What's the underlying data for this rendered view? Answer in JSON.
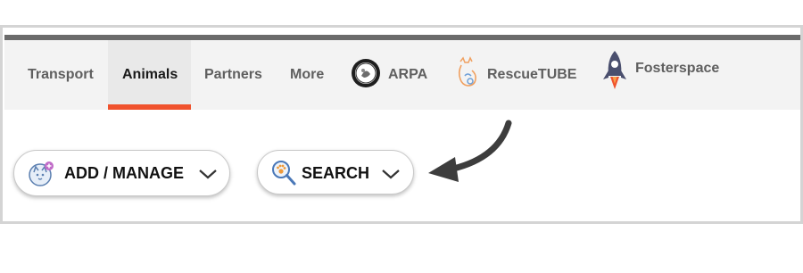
{
  "nav": {
    "items": [
      {
        "label": "Transport",
        "active": false
      },
      {
        "label": "Animals",
        "active": true
      },
      {
        "label": "Partners",
        "active": false
      },
      {
        "label": "More",
        "active": false
      }
    ],
    "brands": [
      {
        "label": "ARPA",
        "icon": "arpa-seal-icon"
      },
      {
        "label": "RescueTUBE",
        "icon": "rescuetube-logo-icon"
      },
      {
        "label": "Fosterspace",
        "icon": "rocket-icon"
      }
    ]
  },
  "actions": {
    "add_manage": {
      "label": "ADD / MANAGE",
      "icon": "pet-add-icon"
    },
    "search": {
      "label": "SEARCH",
      "icon": "magnifier-paw-icon"
    }
  },
  "colors": {
    "accent": "#f0522d",
    "nav_bg": "#f3f3f3",
    "topbar": "#6b6b6b"
  }
}
